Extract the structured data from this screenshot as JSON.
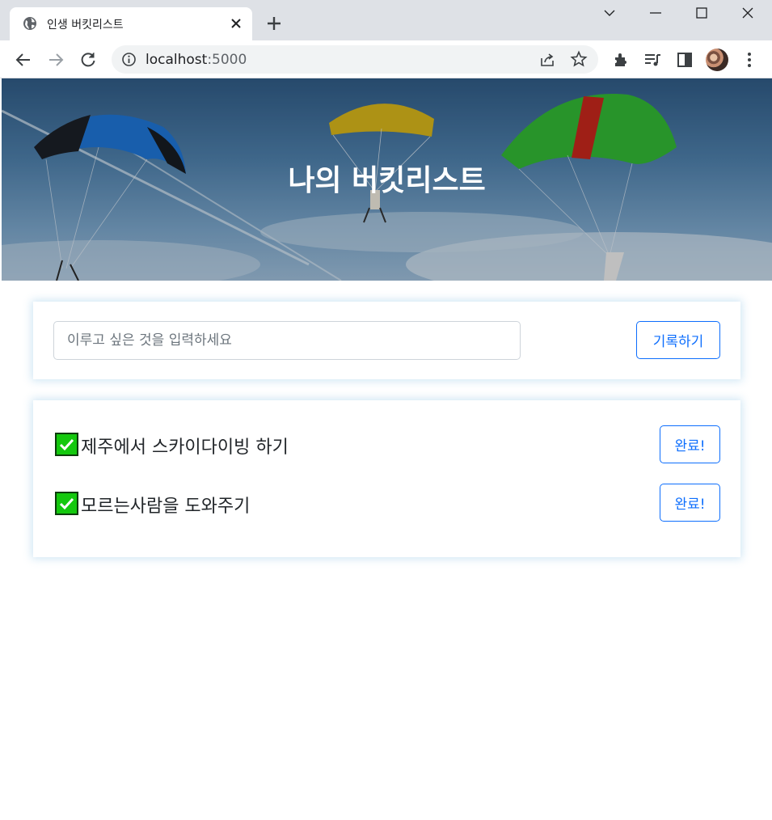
{
  "browser": {
    "tab_title": "인생 버킷리스트",
    "url_host": "localhost",
    "url_port": ":5000"
  },
  "hero": {
    "title": "나의 버킷리스트"
  },
  "form": {
    "placeholder": "이루고 싶은 것을 입력하세요",
    "value": "",
    "submit_label": "기록하기"
  },
  "buckets": [
    {
      "text": "제주에서 스카이다이빙 하기",
      "button_label": "완료!"
    },
    {
      "text": "모르는사람을 도와주기",
      "button_label": "완료!"
    }
  ],
  "colors": {
    "accent": "#0d6efd",
    "check_green": "#14c80e"
  }
}
